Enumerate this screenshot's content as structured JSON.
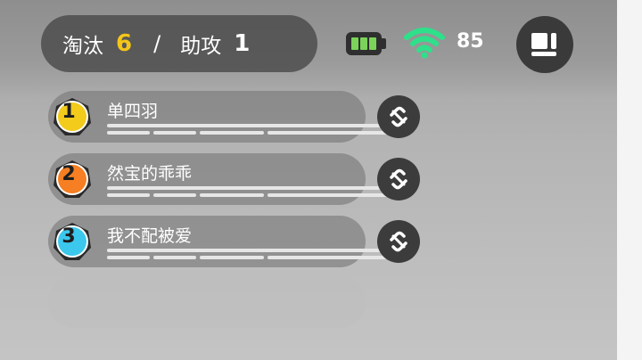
{
  "hud": {
    "kills_label": "淘汰",
    "kills_value": "6",
    "separator": "/",
    "assists_label": "助攻",
    "assists_value": "1",
    "ping": "85"
  },
  "team": [
    {
      "number": "1",
      "name": "单四羽",
      "badge_color": "#f2cb1b"
    },
    {
      "number": "2",
      "name": "然宝的乖乖",
      "badge_color": "#f57f22"
    },
    {
      "number": "3",
      "name": "我不配被爱",
      "badge_color": "#3cc8ec"
    }
  ],
  "colors": {
    "kills_accent": "#f5c518",
    "battery_green": "#7bd35a",
    "wifi_green": "#2ee08a"
  },
  "icons": {
    "battery": "battery-icon",
    "wifi": "wifi-icon",
    "menu": "menu-icon",
    "link": "unlink-icon"
  }
}
